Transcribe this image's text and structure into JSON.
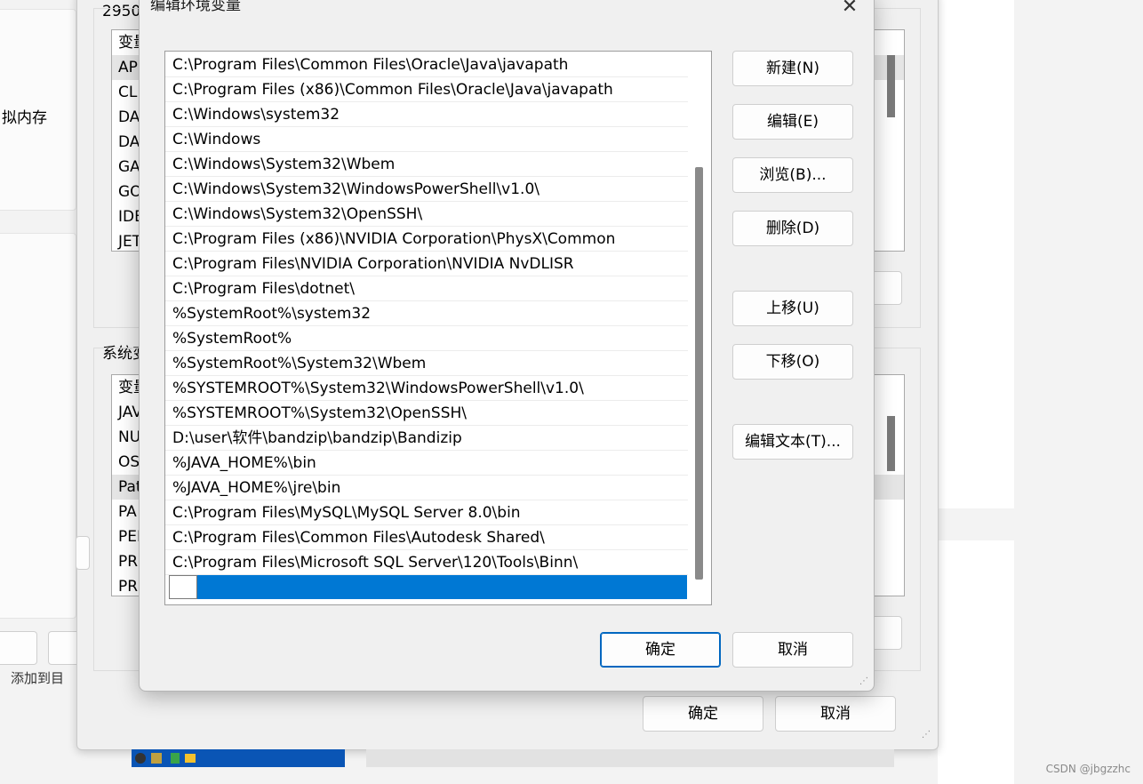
{
  "background": {
    "window_title_fragment": "2950",
    "user_vars_header_fragment": "变量",
    "user_vars_items": [
      "AP",
      "CLI",
      "DA",
      "DA",
      "GA",
      "GO",
      "IDE",
      "JET"
    ],
    "left_text": "拟内存",
    "system_vars_group_fragment": "系统变",
    "system_vars_header_fragment": "变量",
    "system_vars_items": [
      "JAV",
      "NU",
      "OS",
      "Pat",
      "PA",
      "PEF",
      "PR",
      "PR"
    ],
    "bottom_left_text": "添加到目",
    "ok_label": "确定",
    "cancel_label": "取消",
    "watermark": "CSDN @jbgzzhc"
  },
  "dialog": {
    "title": "编辑环境变量",
    "close_glyph": "✕",
    "paths": [
      "C:\\Program Files\\Common Files\\Oracle\\Java\\javapath",
      "C:\\Program Files (x86)\\Common Files\\Oracle\\Java\\javapath",
      "C:\\Windows\\system32",
      "C:\\Windows",
      "C:\\Windows\\System32\\Wbem",
      "C:\\Windows\\System32\\WindowsPowerShell\\v1.0\\",
      "C:\\Windows\\System32\\OpenSSH\\",
      "C:\\Program Files (x86)\\NVIDIA Corporation\\PhysX\\Common",
      "C:\\Program Files\\NVIDIA Corporation\\NVIDIA NvDLISR",
      "C:\\Program Files\\dotnet\\",
      "%SystemRoot%\\system32",
      "%SystemRoot%",
      "%SystemRoot%\\System32\\Wbem",
      "%SYSTEMROOT%\\System32\\WindowsPowerShell\\v1.0\\",
      "%SYSTEMROOT%\\System32\\OpenSSH\\",
      "D:\\user\\软件\\bandzip\\bandzip\\Bandizip",
      "%JAVA_HOME%\\bin",
      "%JAVA_HOME%\\jre\\bin",
      "C:\\Program Files\\MySQL\\MySQL Server 8.0\\bin",
      "C:\\Program Files\\Common Files\\Autodesk Shared\\",
      "C:\\Program Files\\Microsoft SQL Server\\120\\Tools\\Binn\\"
    ],
    "new_entry_value": "",
    "buttons": {
      "new": "新建(N)",
      "edit": "编辑(E)",
      "browse": "浏览(B)...",
      "delete": "删除(D)",
      "move_up": "上移(U)",
      "move_down": "下移(O)",
      "edit_text": "编辑文本(T)...",
      "ok": "确定",
      "cancel": "取消"
    }
  },
  "colors": {
    "selection": "#0078d4",
    "primary_border": "#0067c0"
  }
}
